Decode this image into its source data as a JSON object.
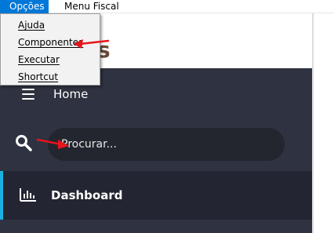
{
  "menubar": {
    "items": [
      {
        "label": "Opções",
        "active": true
      },
      {
        "label": "Menu Fiscal",
        "active": false
      }
    ]
  },
  "dropdown": {
    "items": [
      {
        "label": "Ajuda"
      },
      {
        "label": "Componentes"
      },
      {
        "label": "Executar"
      },
      {
        "label": "Shortcut"
      }
    ]
  },
  "header": {
    "logo_fragment": "s"
  },
  "sidebar": {
    "home_label": "Home",
    "search_placeholder": "Procurar...",
    "dashboard_label": "Dashboard"
  },
  "colors": {
    "menu_active": "#0078d7",
    "sidebar_bg": "#2f3240",
    "search_bg": "#23252f",
    "accent": "#1ab0e0",
    "annotation": "#e8141c"
  }
}
